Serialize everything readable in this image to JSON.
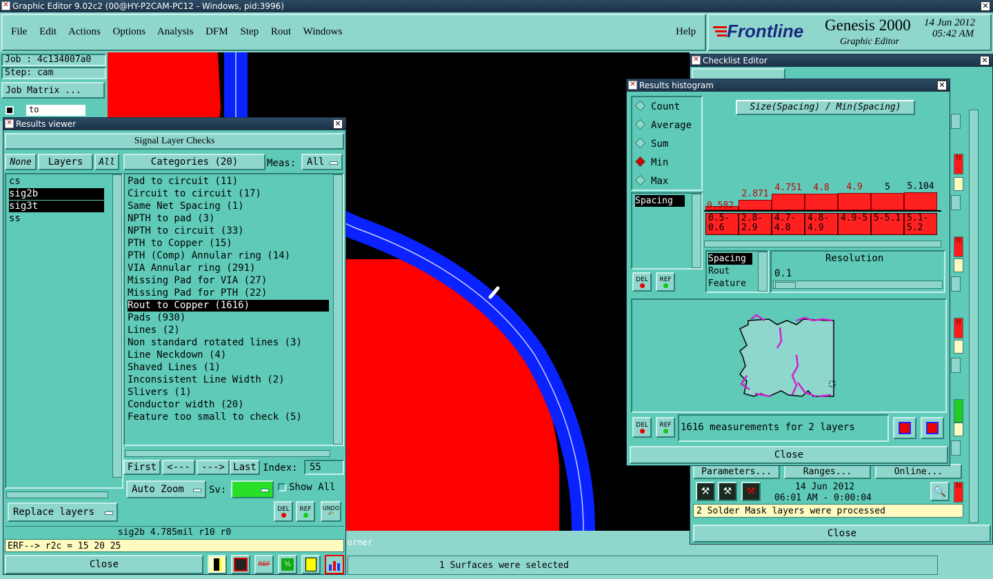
{
  "window_title": "Graphic Editor 9.02c2 (00@HY-P2CAM-PC12 - Windows, pid:3996)",
  "menu": [
    "File",
    "Edit",
    "Actions",
    "Options",
    "Analysis",
    "DFM",
    "Step",
    "Rout",
    "Windows"
  ],
  "help_label": "Help",
  "brand": {
    "logo": "Frontline",
    "product": "Genesis 2000",
    "subtitle": "Graphic Editor",
    "date": "14 Jun 2012",
    "time": "05:42 AM"
  },
  "left_info": {
    "job": "Job : 4c134007a0",
    "step": "Step: cam",
    "job_matrix": "Job Matrix ...",
    "to_field": "to"
  },
  "results_viewer": {
    "title": "Results viewer",
    "header": "Signal Layer Checks",
    "none_btn": "None",
    "layers_btn": "Layers",
    "all_btn": "All",
    "categories_btn": "Categories (20)",
    "meas_label": "Meas:",
    "meas_value": "All",
    "layers": [
      "cs",
      "sig2b",
      "sig3t",
      "ss"
    ],
    "categories": [
      "Pad to circuit (11)",
      "Circuit to circuit (17)",
      "Same Net Spacing (1)",
      "NPTH to pad (3)",
      "NPTH to circuit (33)",
      "PTH to Copper (15)",
      "PTH (Comp) Annular ring (14)",
      "VIA Annular ring (291)",
      "Missing Pad for VIA (27)",
      "Missing Pad for PTH (22)",
      "Rout to Copper (1616)",
      "Pads (930)",
      "Lines (2)",
      "Non standard rotated lines (3)",
      "Line Neckdown (4)",
      "Shaved Lines (1)",
      "Inconsistent Line Width (2)",
      "Slivers (1)",
      "Conductor width (20)",
      "Feature too small to check (5)"
    ],
    "first": "First",
    "prev": "<---",
    "next": "--->",
    "last": "Last",
    "index_label": "Index:",
    "index_value": "55",
    "auto_zoom": "Auto Zoom",
    "sv_label": "Sv:",
    "show_all": "Show All",
    "replace_layers": "Replace layers",
    "del": "DEL",
    "ref": "REF",
    "undo": "UNDO",
    "status": "sig2b 4.785mil   r10   r0",
    "erf": "ERF--> r2c = 15 20 25",
    "close": "Close"
  },
  "histogram": {
    "title": "Results histogram",
    "modes": [
      "Count",
      "Average",
      "Sum",
      "Min",
      "Max"
    ],
    "selected_mode": "Min",
    "formula": "Size(Spacing) / Min(Spacing)",
    "top_values": [
      "0.582",
      "2.871",
      "4.751",
      "4.8",
      "4.9",
      "5",
      "5.104"
    ],
    "ranges": [
      "0.5-0.6",
      "2.8-2.9",
      "4.7-4.8",
      "4.8-4.9",
      "4.9-5",
      "5-5.1",
      "5.1-5.2"
    ],
    "bar_values": [
      0.582,
      2.871,
      4.751,
      4.8,
      4.9,
      5,
      5.104
    ],
    "attr_list": [
      "Spacing"
    ],
    "type_list": [
      "Spacing",
      "Rout",
      "Feature"
    ],
    "resolution_label": "Resolution",
    "resolution_value": "0.1",
    "measurement_text": "1616 measurements for 2 layers",
    "del": "DEL",
    "ref": "REF",
    "close": "Close"
  },
  "checklist": {
    "title": "Checklist Editor",
    "parameters": "Parameters...",
    "ranges": "Ranges...",
    "online": "Online...",
    "date": "14 Jun 2012",
    "time": "06:01 AM - 0:00:04",
    "message": "2 Solder Mask layers were processed",
    "close": "Close"
  },
  "canvas_status_fragment": "orner",
  "bottom_status": "1 Surfaces were selected",
  "colors": {
    "panel": "#5fcab8",
    "panel_light": "#8fd6cc",
    "copper": "#ff0000",
    "trace": "#0022ff",
    "canvas": "#000000",
    "highlight": "#ff2a2a"
  },
  "toolbar_icons": [
    "ruler-icon",
    "layer-icon",
    "reference-icon",
    "counter-icon",
    "report-icon",
    "histogram-icon"
  ]
}
